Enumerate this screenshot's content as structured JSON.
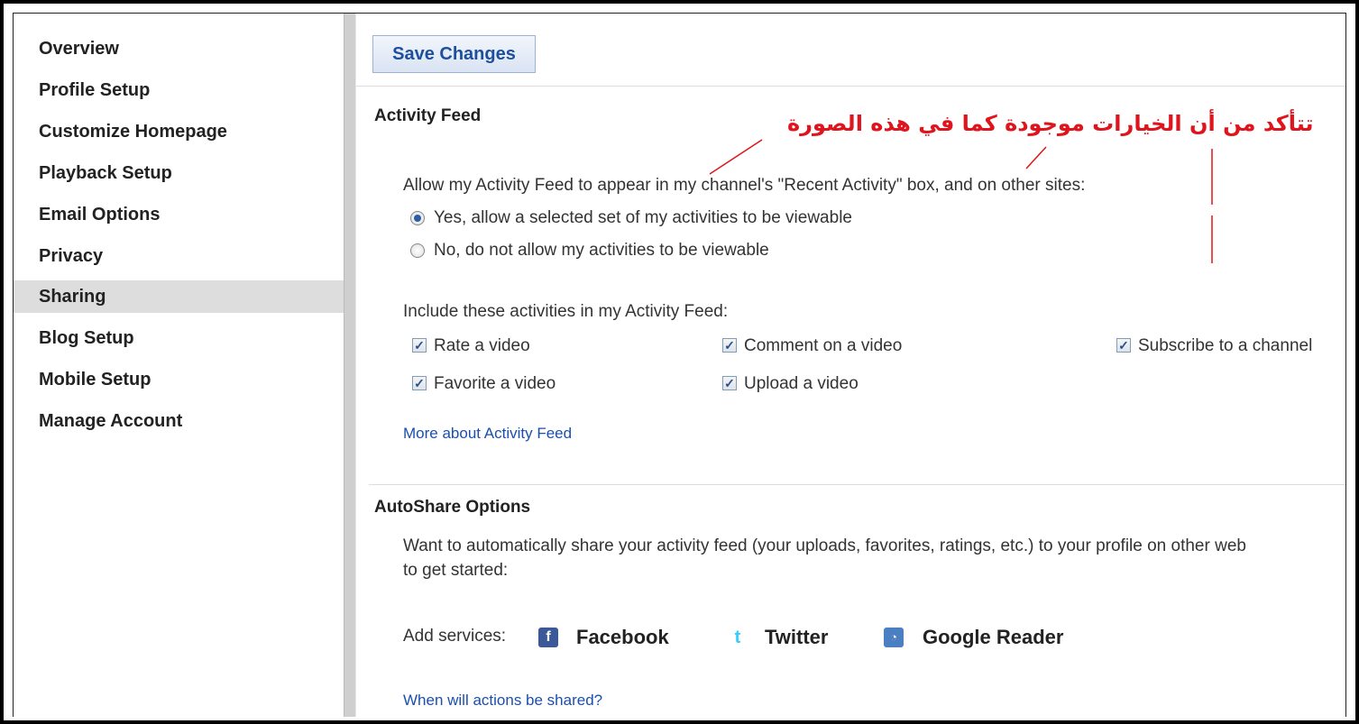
{
  "sidebar": {
    "items": [
      {
        "label": "Overview"
      },
      {
        "label": "Profile Setup"
      },
      {
        "label": "Customize Homepage"
      },
      {
        "label": "Playback Setup"
      },
      {
        "label": "Email Options"
      },
      {
        "label": "Privacy"
      },
      {
        "label": "Sharing",
        "active": true
      },
      {
        "label": "Blog Setup"
      },
      {
        "label": "Mobile Setup"
      },
      {
        "label": "Manage Account"
      }
    ]
  },
  "toolbar": {
    "save_label": "Save Changes"
  },
  "activity_feed": {
    "heading": "Activity Feed",
    "annotation": "تتأكد من أن الخيارات موجودة كما في هذه الصورة",
    "allow_question": "Allow my Activity Feed to appear in my channel's \"Recent Activity\" box, and on other sites:",
    "radio_yes": "Yes, allow a selected set of my activities to be viewable",
    "radio_no": "No, do not allow my activities to be viewable",
    "radio_selected": "yes",
    "include_label": "Include these activities in my Activity Feed:",
    "checkboxes": [
      {
        "label": "Rate a video",
        "checked": true
      },
      {
        "label": "Comment on a video",
        "checked": true
      },
      {
        "label": "Subscribe to a channel",
        "checked": true
      },
      {
        "label": "Favorite a video",
        "checked": true
      },
      {
        "label": "Upload a video",
        "checked": true
      }
    ],
    "more_link": "More about Activity Feed"
  },
  "autoshare": {
    "heading": "AutoShare Options",
    "description_line1": "Want to automatically share your activity feed (your uploads, favorites, ratings, etc.) to your profile on other web",
    "description_line2": "to get started:",
    "add_services_label": "Add services:",
    "services": [
      {
        "name": "Facebook",
        "icon": "facebook-icon",
        "color": "#3b5998"
      },
      {
        "name": "Twitter",
        "icon": "twitter-icon",
        "color": "#33ccff"
      },
      {
        "name": "Google Reader",
        "icon": "rss-icon",
        "color": "#4a7fc1"
      }
    ],
    "when_link": "When will actions be shared?"
  },
  "colors": {
    "accent": "#1d4f9c",
    "annotation": "#e0141c",
    "sidebar_active": "#dddddd"
  }
}
